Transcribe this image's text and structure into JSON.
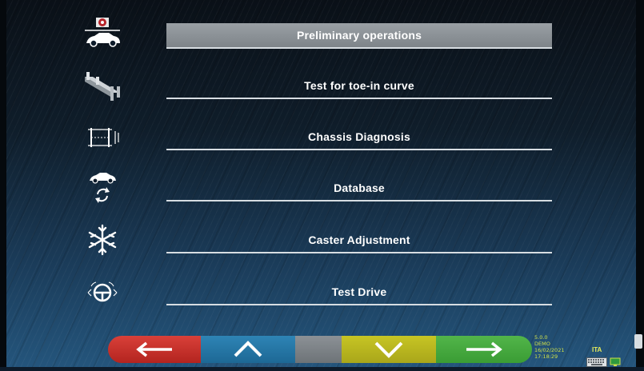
{
  "menu": {
    "items": [
      {
        "label": "Preliminary operations",
        "icon": "car-wheel-icon",
        "selected": true
      },
      {
        "label": "Test for toe-in curve",
        "icon": "lift-ramp-icon",
        "selected": false
      },
      {
        "label": "Chassis Diagnosis",
        "icon": "chassis-measure-icon",
        "selected": false
      },
      {
        "label": "Database",
        "icon": "car-refresh-icon",
        "selected": false
      },
      {
        "label": "Caster Adjustment",
        "icon": "snowflake-icon",
        "selected": false
      },
      {
        "label": "Test Drive",
        "icon": "steering-wheel-icon",
        "selected": false
      }
    ]
  },
  "nav": {
    "back_icon": "arrow-left-icon",
    "up_icon": "chevron-up-icon",
    "down_icon": "chevron-down-icon",
    "forward_icon": "arrow-right-icon",
    "colors": {
      "back": "#c9302c",
      "up": "#2577a8",
      "mid": "#7d8287",
      "down": "#b8b620",
      "forward": "#47a941"
    }
  },
  "status": {
    "version": "5.0.0",
    "mode": "DEMO",
    "date": "16/02/2021",
    "time": "17:18:29",
    "language": "ITA"
  }
}
